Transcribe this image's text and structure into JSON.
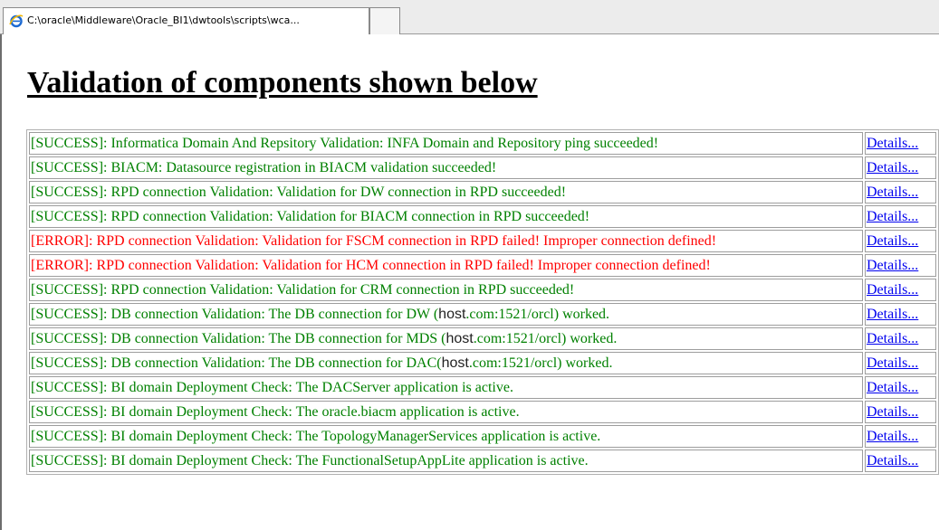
{
  "browser": {
    "tab_title": "C:\\oracle\\Middleware\\Oracle_BI1\\dwtools\\scripts\\wca...",
    "tab_icon": "ie-icon"
  },
  "page": {
    "heading": "Validation of components shown below"
  },
  "colors": {
    "success": "#008000",
    "error": "#ff0000",
    "link": "#0000ee"
  },
  "results": [
    {
      "status": "success",
      "text": "[SUCCESS]: Informatica Domain And Repsitory Validation: INFA Domain and Repository ping succeeded!",
      "link": "Details..."
    },
    {
      "status": "success",
      "text": "[SUCCESS]: BIACM: Datasource registration in BIACM validation succeeded!",
      "link": "Details..."
    },
    {
      "status": "success",
      "text": "[SUCCESS]: RPD connection Validation: Validation for DW connection in RPD succeeded!",
      "link": "Details..."
    },
    {
      "status": "success",
      "text": "[SUCCESS]: RPD connection Validation: Validation for BIACM connection in RPD succeeded!",
      "link": "Details..."
    },
    {
      "status": "error",
      "text": "[ERROR]: RPD connection Validation: Validation for FSCM connection in RPD failed! Improper connection defined!",
      "link": "Details..."
    },
    {
      "status": "error",
      "text": "[ERROR]: RPD connection Validation: Validation for HCM connection in RPD failed! Improper connection defined!",
      "link": "Details..."
    },
    {
      "status": "success",
      "text": "[SUCCESS]: RPD connection Validation: Validation for CRM connection in RPD succeeded!",
      "link": "Details..."
    },
    {
      "status": "success",
      "pre": "[SUCCESS]: DB connection Validation: The DB connection for DW (",
      "host": "host",
      "post": ".com:1521/orcl) worked.",
      "link": "Details..."
    },
    {
      "status": "success",
      "pre": "[SUCCESS]: DB connection Validation: The DB connection for MDS (",
      "host": "host",
      "post": ".com:1521/orcl) worked.",
      "link": "Details..."
    },
    {
      "status": "success",
      "pre": "[SUCCESS]: DB connection Validation: The DB connection for DAC(",
      "host": "host",
      "post": ".com:1521/orcl) worked.",
      "link": "Details..."
    },
    {
      "status": "success",
      "text": "[SUCCESS]: BI domain Deployment Check: The DACServer application is active.",
      "link": "Details..."
    },
    {
      "status": "success",
      "text": "[SUCCESS]: BI domain Deployment Check: The oracle.biacm application is active.",
      "link": "Details..."
    },
    {
      "status": "success",
      "text": "[SUCCESS]: BI domain Deployment Check: The TopologyManagerServices application is active.",
      "link": "Details..."
    },
    {
      "status": "success",
      "text": "[SUCCESS]: BI domain Deployment Check: The FunctionalSetupAppLite application is active.",
      "link": "Details..."
    }
  ]
}
